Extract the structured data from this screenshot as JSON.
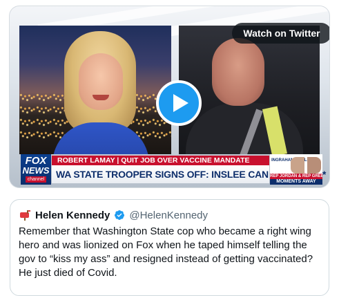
{
  "video": {
    "watch_label": "Watch on Twitter",
    "chyron": {
      "network_line1": "FOX",
      "network_line2": "NEWS",
      "network_line3": "channel",
      "top_line": "ROBERT LAMAY | QUIT JOB OVER VACCINE MANDATE",
      "headline": "WA STATE TROOPER SIGNS OFF: INSLEE CAN KISS MY A**",
      "promo_show": "INGRAHAM ANGLE",
      "promo_tag": "REP JORDAN & REP GREEN",
      "promo_away": "MOMENTS AWAY"
    }
  },
  "quote": {
    "name": "Helen Kennedy",
    "handle": "@HelenKennedy",
    "text": "Remember that Washington State cop who became a right wing hero and was lionized on Fox when he taped himself telling the gov to “kiss my ass” and resigned instead of getting vaccinated? He just died of Covid."
  },
  "icons": {
    "avatar": "mailbox-icon",
    "verified": "verified-badge-icon",
    "play": "play-icon"
  },
  "colors": {
    "twitter_blue": "#1d9bf0",
    "fox_red": "#c8102e",
    "fox_navy": "#0d2e6b"
  }
}
